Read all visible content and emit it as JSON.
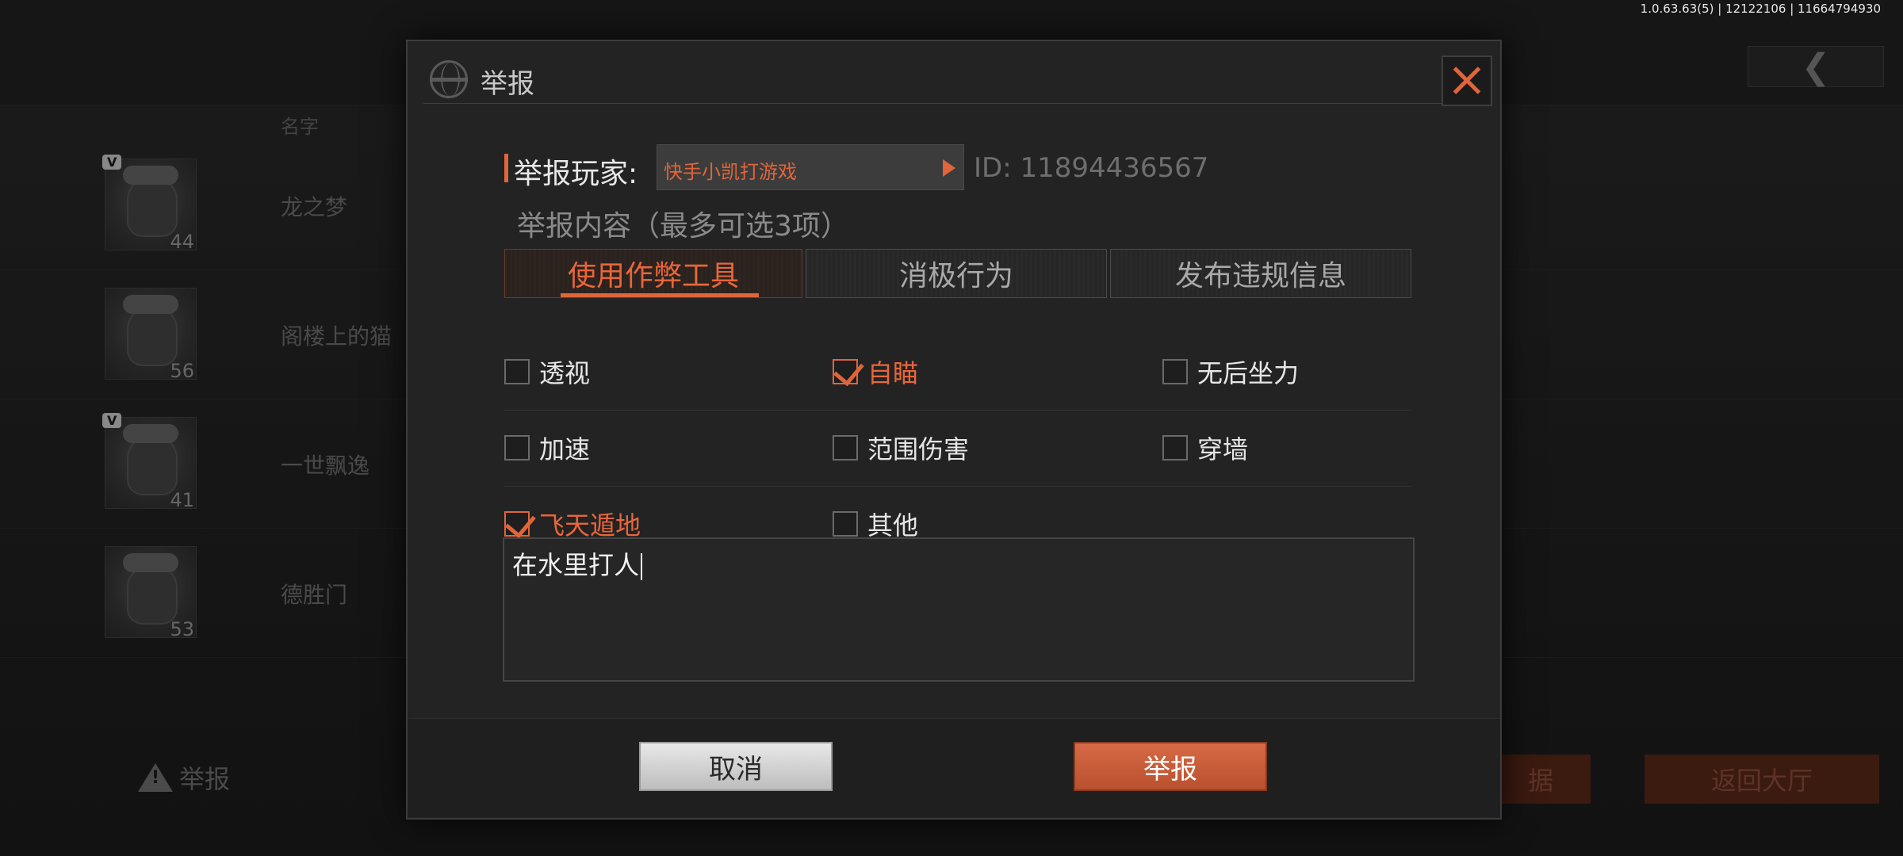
{
  "app": {
    "version": "1.0.63.63(5) | 12122106 | 11664794930"
  },
  "background": {
    "back_icon": "chevron-left-icon",
    "column_header": "名字",
    "players": [
      {
        "name": "龙之梦",
        "level": "44",
        "badge": "V"
      },
      {
        "name": "阁楼上的猫",
        "level": "56",
        "badge": ""
      },
      {
        "name": "一世飘逸",
        "level": "41",
        "badge": "V"
      },
      {
        "name": "德胜门",
        "level": "53",
        "badge": ""
      }
    ],
    "report_label": "举报",
    "data_button": "据",
    "lobby_button": "返回大厅"
  },
  "modal": {
    "title": "举报",
    "reporter_label": "举报玩家:",
    "player_name": "快手小凯打游戏",
    "player_id": "ID: 11894436567",
    "content_label": "举报内容（最多可选3项）",
    "tabs": [
      {
        "label": "使用作弊工具",
        "active": true
      },
      {
        "label": "消极行为",
        "active": false
      },
      {
        "label": "发布违规信息",
        "active": false
      }
    ],
    "options": [
      {
        "label": "透视",
        "checked": false
      },
      {
        "label": "自瞄",
        "checked": true
      },
      {
        "label": "无后坐力",
        "checked": false
      },
      {
        "label": "加速",
        "checked": false
      },
      {
        "label": "范围伤害",
        "checked": false
      },
      {
        "label": "穿墙",
        "checked": false
      },
      {
        "label": "飞天遁地",
        "checked": true
      },
      {
        "label": "其他",
        "checked": false
      }
    ],
    "description": "在水里打人",
    "cancel_button": "取消",
    "report_button": "举报"
  },
  "colors": {
    "accent": "#e0653a",
    "panel": "#232323",
    "text": "#e6e6e6"
  }
}
